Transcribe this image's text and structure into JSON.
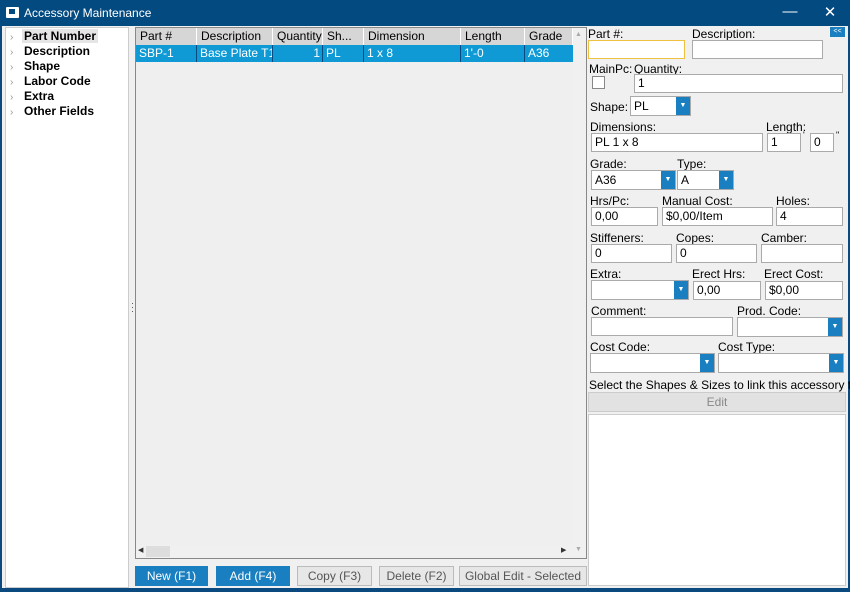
{
  "window": {
    "title": "Accessory Maintenance",
    "minimize": "—",
    "close": "✕"
  },
  "tree": {
    "items": [
      {
        "label": "Part Number",
        "selected": true
      },
      {
        "label": "Description"
      },
      {
        "label": "Shape"
      },
      {
        "label": "Labor Code"
      },
      {
        "label": "Extra"
      },
      {
        "label": "Other Fields"
      }
    ]
  },
  "grid": {
    "columns": [
      "Part #",
      "Description",
      "Quantity",
      "Sh...",
      "Dimension",
      "Length",
      "Grade"
    ],
    "rows": [
      [
        "SBP-1",
        "Base Plate T1",
        "1",
        "PL",
        "1 x 8",
        "1'-0",
        "A36"
      ]
    ]
  },
  "buttons": {
    "new": "New (F1)",
    "add": "Add (F4)",
    "copy": "Copy (F3)",
    "delete": "Delete (F2)",
    "global_edit": "Global Edit - Selected"
  },
  "form": {
    "collapse": "<<",
    "part_label": "Part #:",
    "part_value": "",
    "desc_label": "Description:",
    "desc_value": "",
    "mainpc_label": "MainPc:",
    "qty_label": "Quantity:",
    "qty_value": "1",
    "shape_label": "Shape:",
    "shape_value": "PL",
    "dim_label": "Dimensions:",
    "dim_value": "PL 1 x 8",
    "length_label": "Length:",
    "length_ft": "1",
    "length_in": "0",
    "ft_mark": "'",
    "in_mark": "\"",
    "grade_label": "Grade:",
    "grade_value": "A36",
    "type_label": "Type:",
    "type_value": "A",
    "hrs_label": "Hrs/Pc:",
    "hrs_value": "0,00",
    "manual_label": "Manual Cost:",
    "manual_value": "$0,00/Item",
    "holes_label": "Holes:",
    "holes_value": "4",
    "stiff_label": "Stiffeners:",
    "stiff_value": "0",
    "copes_label": "Copes:",
    "copes_value": "0",
    "camber_label": "Camber:",
    "camber_value": "",
    "extra_label": "Extra:",
    "extra_value": "",
    "erect_hrs_label": "Erect Hrs:",
    "erect_hrs_value": "0,00",
    "erect_cost_label": "Erect Cost:",
    "erect_cost_value": "$0,00",
    "comment_label": "Comment:",
    "comment_value": "",
    "prod_label": "Prod. Code:",
    "prod_value": "",
    "cost_code_label": "Cost Code:",
    "cost_code_value": "",
    "cost_type_label": "Cost Type:",
    "cost_type_value": "",
    "link_text": "Select the Shapes & Sizes to link this accessory to.",
    "edit": "Edit"
  }
}
